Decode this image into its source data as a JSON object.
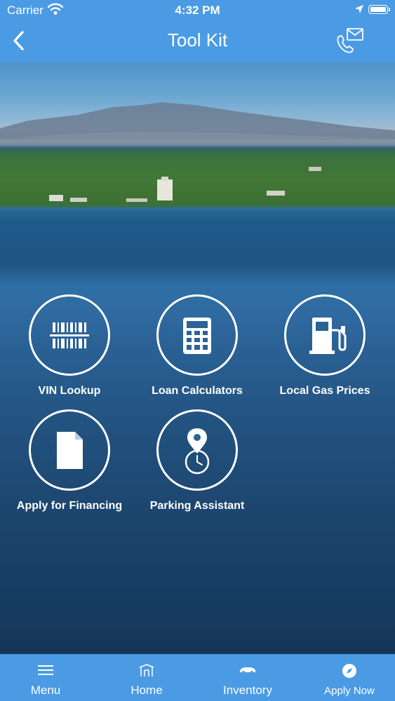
{
  "status_bar": {
    "carrier": "Carrier",
    "time": "4:32 PM"
  },
  "nav": {
    "title": "Tool Kit",
    "back_icon": "chevron-left-icon",
    "contact_icon": "phone-email-icon"
  },
  "tools": [
    {
      "label": "VIN Lookup",
      "icon": "barcode-icon"
    },
    {
      "label": "Loan Calculators",
      "icon": "calculator-icon"
    },
    {
      "label": "Local Gas Prices",
      "icon": "gas-pump-icon"
    },
    {
      "label": "Apply for Financing",
      "icon": "document-icon"
    },
    {
      "label": "Parking Assistant",
      "icon": "location-timer-icon"
    }
  ],
  "tab_bar": {
    "items": [
      {
        "label": "Menu",
        "icon": "hamburger-icon"
      },
      {
        "label": "Home",
        "icon": "dealership-icon"
      },
      {
        "label": "Inventory",
        "icon": "car-icon"
      },
      {
        "label": "Apply Now",
        "icon": "compass-icon"
      }
    ]
  },
  "colors": {
    "bar": "#4a9be3",
    "text": "#ffffff"
  }
}
